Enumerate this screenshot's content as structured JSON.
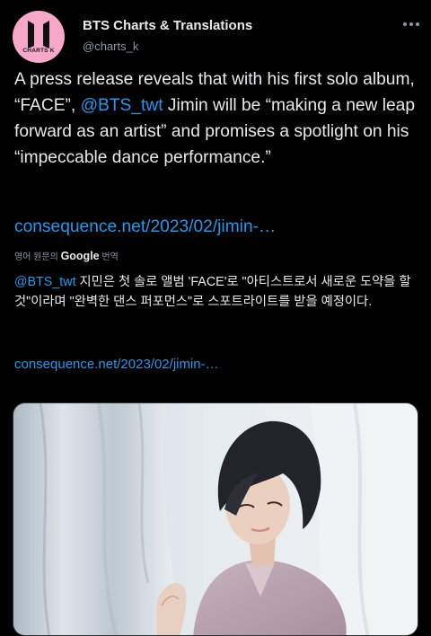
{
  "account": {
    "display_name": "BTS Charts & Translations",
    "handle": "@charts_k",
    "avatar_text": "CHARTS K"
  },
  "tweet": {
    "text_before": "A press release reveals that with his first solo album, “FACE”, ",
    "mention": "@BTS_twt",
    "text_after": " Jimin will be “making a new leap forward as an artist” and promises a spotlight on his “impeccable dance performance.”",
    "link": "consequence.net/2023/02/jimin-…"
  },
  "translation": {
    "label_before": "영어 원문의 ",
    "label_brand": "Google",
    "label_after": " 번역",
    "mention": "@BTS_twt",
    "text": " 지민은 첫 솔로 앨범 'FACE'로 \"아티스트로서 새로운 도약을 할 것\"이라며 \"완벽한 댄스 퍼포먼스\"로 스포트라이트를 받을 예정이다.",
    "link": "consequence.net/2023/02/jimin-…"
  },
  "icons": {
    "more": "more-dots-icon",
    "avatar_logo": "bts-logo-icon"
  },
  "colors": {
    "background": "#000000",
    "text": "#e7e9ea",
    "secondary": "#8b98a5",
    "link": "#1d9bf0",
    "avatar_bg": "#f7a8c8"
  }
}
